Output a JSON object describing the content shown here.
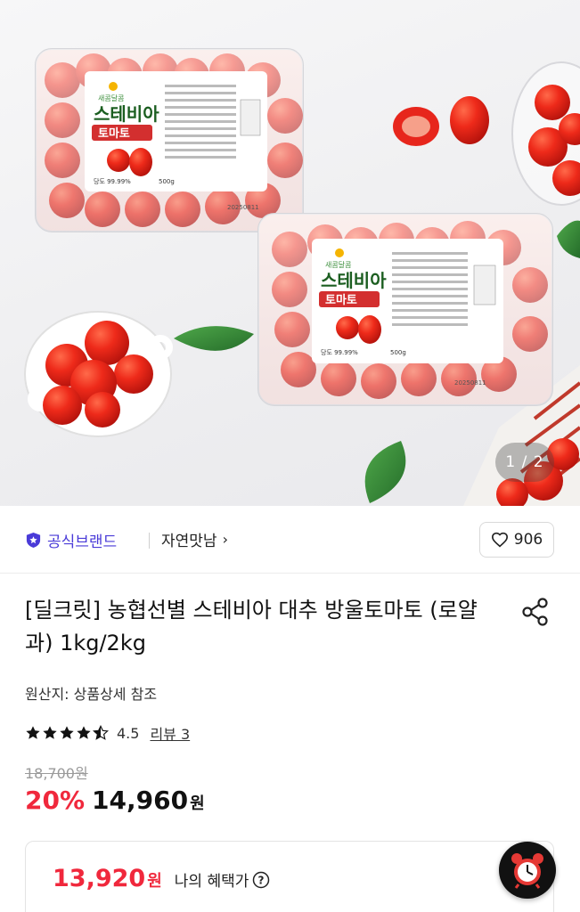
{
  "gallery": {
    "counter": "1 / 2",
    "package_brand": "새콤달콤",
    "package_title_line1": "스테비아",
    "package_title_line2": "토마토",
    "package_weight": "500g",
    "package_sugar": "당도 99.99%",
    "package_date": "20250811"
  },
  "brand": {
    "badge_label": "공식브랜드",
    "store_name": "자연맛남",
    "store_chevron": "›",
    "like_count": "906"
  },
  "product": {
    "title": "[딜크릿] 농협선별 스테비아 대추 방울토마토 (로얄과) 1kg/2kg",
    "origin": "원산지: 상품상세 참조",
    "rating": "4.5",
    "rating_stars": 4.5,
    "review_label": "리뷰 3",
    "original_price": "18,700원",
    "discount": "20%",
    "price": "14,960",
    "price_unit": "원"
  },
  "benefit": {
    "price": "13,920",
    "unit": "원",
    "label": "나의 혜택가"
  },
  "colors": {
    "brand_badge": "#4a3bd8",
    "discount_red": "#f0283c"
  },
  "icons": {
    "badge": "star-shield-icon",
    "like": "heart-icon",
    "share": "share-icon",
    "help": "question-circle-icon",
    "timer": "alarm-clock-icon"
  }
}
